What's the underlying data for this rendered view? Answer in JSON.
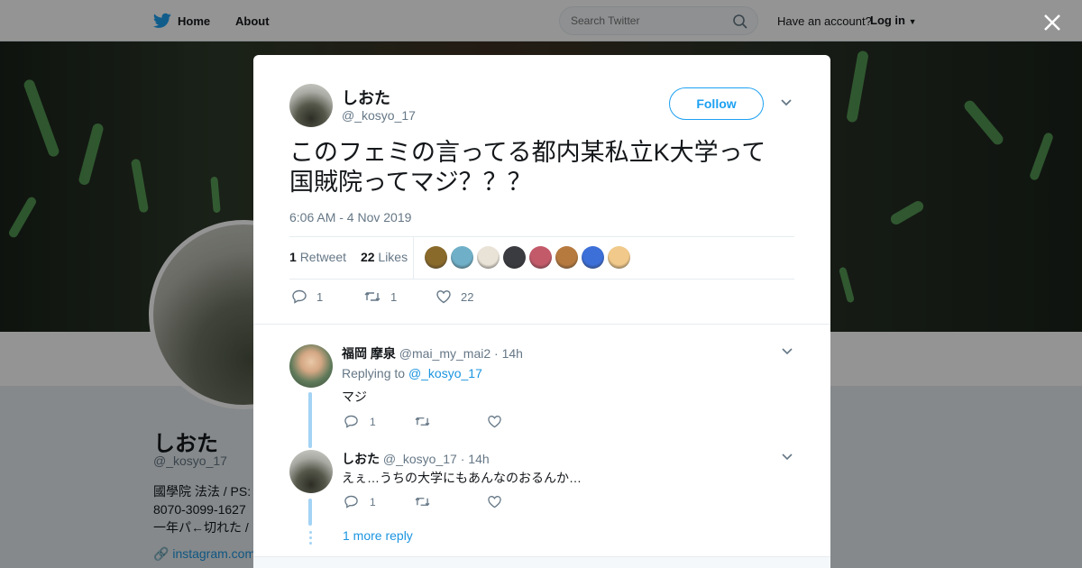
{
  "nav": {
    "home_label": "Home",
    "about_label": "About",
    "search_placeholder": "Search Twitter",
    "account_question": "Have an account?",
    "login_label": "Log in"
  },
  "profile_bg": {
    "name": "しおた",
    "handle": "@_kosyo_17",
    "bio_lines": [
      "國學院 法法 / PS:",
      "8070-3099-1627 ",
      "一年パ←切れた / "
    ],
    "link": "instagram.com"
  },
  "tweet": {
    "author_name": "しおた",
    "author_handle": "@_kosyo_17",
    "follow_label": "Follow",
    "text_line1": "このフェミの言ってる都内某私立K大学って",
    "text_line2": "国賊院ってマジ？？？",
    "timestamp": "6:06 AM - 4 Nov 2019",
    "retweet_count": "1",
    "retweet_label": "Retweet",
    "like_count": "22",
    "like_label": "Likes",
    "likers_colors": [
      "#8a6a2a",
      "#6fb0c8",
      "#e9e2d6",
      "#3a3b40",
      "#c35a6a",
      "#b77a3e",
      "#3c6fd8",
      "#f1c98a"
    ],
    "actions": {
      "reply_count": "1",
      "retweet_count": "1",
      "like_count": "22"
    }
  },
  "replies": [
    {
      "name": "福岡 摩泉",
      "handle": "@mai_my_mai2",
      "time": "14h",
      "replying_prefix": "Replying to",
      "replying_to": "@_kosyo_17",
      "text": "マジ",
      "reply_count": "1",
      "retweet_count": "",
      "like_count": ""
    },
    {
      "name": "しおた",
      "handle": "@_kosyo_17",
      "time": "14h",
      "text": "えぇ…うちの大学にもあんなのおるんか…",
      "reply_count": "1",
      "retweet_count": "",
      "like_count": ""
    }
  ],
  "more_replies_label": "1 more reply",
  "colors": {
    "accent": "#1da1f2",
    "link": "#1b95e0",
    "thread": "#a3d3f5"
  }
}
